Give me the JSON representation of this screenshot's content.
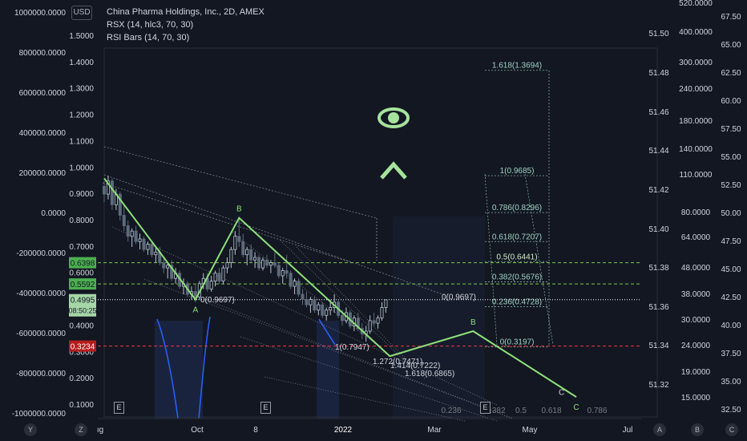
{
  "header": {
    "currency": "USD",
    "title": "China Pharma Holdings, Inc., 2D, AMEX",
    "indicator1": "RSX (14, hlc3, 70, 30)",
    "indicator2": "RSI Bars (14, 70, 30)"
  },
  "colors": {
    "background": "#131722",
    "wave": "#8ee07a",
    "up_candle": "#b7c4cf",
    "down_candle": "#5c6b7a",
    "green_dashed": "#7ec84a",
    "red_dashed": "#f23645",
    "white_dotted": "#ffffff",
    "fib_text": "#9fd3c7"
  },
  "chart_data": {
    "type": "candlestick",
    "title": "China Pharma Holdings, Inc., 2D, AMEX",
    "x_ticks": [
      "ıg",
      "Oct",
      "8",
      "2022",
      "Mar",
      "May",
      "Jul"
    ],
    "axes": {
      "far_left": {
        "ticks": [
          "1000000.0000",
          "800000.0000",
          "600000.0000",
          "400000.0000",
          "200000.0000",
          "0.0000",
          "-200000.0000",
          "-400000.0000",
          "-600000.0000",
          "-800000.0000",
          "-1000000.0000"
        ],
        "ylim": [
          -1000000,
          1000000
        ]
      },
      "left_price": {
        "ticks": [
          "1.5000",
          "1.4000",
          "1.3000",
          "1.2000",
          "1.1000",
          "1.0000",
          "0.9000",
          "0.8000",
          "0.7000",
          "0.6000",
          "0.5000",
          "0.4000",
          "0.3000",
          "0.2000",
          "0.1000"
        ],
        "ylim": [
          0.06,
          1.52
        ]
      },
      "mid": {
        "ticks": [
          "51.50",
          "51.48",
          "51.46",
          "51.44",
          "51.42",
          "51.40",
          "51.38",
          "51.36",
          "51.34",
          "51.32"
        ]
      },
      "right_log": {
        "ticks": [
          "520.0000",
          "400.0000",
          "300.0000",
          "240.0000",
          "180.0000",
          "140.0000",
          "110.0000",
          "80.0000",
          "64.0000",
          "48.0000",
          "38.0000",
          "30.0000",
          "24.0000",
          "19.0000",
          "15.0000"
        ]
      },
      "far_right": {
        "ticks": [
          "67.50",
          "65.00",
          "62.50",
          "60.00",
          "57.50",
          "55.00",
          "52.50",
          "50.00",
          "47.50",
          "45.00",
          "42.50",
          "40.00",
          "37.50",
          "35.00",
          "32.50"
        ]
      }
    },
    "price_labels": [
      {
        "value": "0.6398",
        "color": "#4caf50"
      },
      {
        "value": "0.5592",
        "color": "#4caf50"
      },
      {
        "value": "0.4995",
        "sub": "08:50:25",
        "color": "#a5d6a7"
      },
      {
        "value": "0.3234",
        "color": "#b71c1c"
      }
    ],
    "horizontal_lines": [
      {
        "price": 0.6398,
        "style": "green-dashed"
      },
      {
        "price": 0.5592,
        "style": "green-dashed"
      },
      {
        "price": 0.4995,
        "style": "white-dotted"
      },
      {
        "price": 0.3234,
        "style": "red-dashed"
      }
    ],
    "wave_points": [
      {
        "date_index": 0,
        "price": 0.96
      },
      {
        "date_index": 23,
        "price": 0.5,
        "label": "A"
      },
      {
        "date_index": 34,
        "price": 0.81,
        "label": "B"
      },
      {
        "date_index": 72,
        "price": 0.285
      },
      {
        "date_index": 93,
        "price": 0.38,
        "label": "B"
      },
      {
        "date_index": 119,
        "price": 0.13,
        "label": "C"
      }
    ],
    "annotations": [
      {
        "text": "0(0.9697)",
        "price": 0.49
      },
      {
        "text": "1(0.7947)",
        "price": 0.31
      },
      {
        "text": "1.272(0.7471)",
        "price": 0.255
      },
      {
        "text": "1.414(0.7222)",
        "price": 0.24
      },
      {
        "text": "1.618(0.6865)",
        "price": 0.21
      },
      {
        "text": "0(0.9697)",
        "price": 0.5
      },
      {
        "text": "C",
        "price": 0.235
      }
    ],
    "fib_levels": [
      {
        "text": "1.618(1.3694)",
        "price": 1.37
      },
      {
        "text": "1(0.9685)",
        "price": 0.97
      },
      {
        "text": "0.786(0.8296)",
        "price": 0.83
      },
      {
        "text": "0.618(0.7207)",
        "price": 0.72
      },
      {
        "text": "0.5(0.6441)",
        "price": 0.644
      },
      {
        "text": "0.382(0.5676)",
        "price": 0.567
      },
      {
        "text": "0.236(0.4728)",
        "price": 0.473
      },
      {
        "text": "0(0.3197)",
        "price": 0.32
      }
    ],
    "bottom_fib_labels": [
      "0.236",
      "0.382",
      "0.5",
      "0.618",
      "0.786"
    ],
    "candles": [
      [
        0.93,
        0.95,
        0.87,
        0.9
      ],
      [
        0.9,
        0.97,
        0.88,
        0.95
      ],
      [
        0.95,
        0.96,
        0.84,
        0.86
      ],
      [
        0.86,
        0.92,
        0.84,
        0.9
      ],
      [
        0.9,
        0.91,
        0.8,
        0.82
      ],
      [
        0.82,
        0.86,
        0.76,
        0.78
      ],
      [
        0.78,
        0.8,
        0.72,
        0.74
      ],
      [
        0.74,
        0.77,
        0.7,
        0.76
      ],
      [
        0.76,
        0.78,
        0.71,
        0.72
      ],
      [
        0.72,
        0.75,
        0.69,
        0.73
      ],
      [
        0.73,
        0.74,
        0.68,
        0.69
      ],
      [
        0.69,
        0.72,
        0.67,
        0.71
      ],
      [
        0.71,
        0.72,
        0.66,
        0.67
      ],
      [
        0.67,
        0.7,
        0.64,
        0.68
      ],
      [
        0.68,
        0.7,
        0.63,
        0.64
      ],
      [
        0.64,
        0.66,
        0.6,
        0.62
      ],
      [
        0.62,
        0.64,
        0.58,
        0.63
      ],
      [
        0.63,
        0.65,
        0.57,
        0.58
      ],
      [
        0.58,
        0.62,
        0.56,
        0.6
      ],
      [
        0.6,
        0.61,
        0.54,
        0.55
      ],
      [
        0.55,
        0.58,
        0.52,
        0.56
      ],
      [
        0.56,
        0.57,
        0.51,
        0.52
      ],
      [
        0.52,
        0.55,
        0.5,
        0.53
      ],
      [
        0.53,
        0.56,
        0.49,
        0.51
      ],
      [
        0.51,
        0.57,
        0.5,
        0.56
      ],
      [
        0.56,
        0.6,
        0.54,
        0.58
      ],
      [
        0.58,
        0.6,
        0.53,
        0.54
      ],
      [
        0.54,
        0.59,
        0.53,
        0.57
      ],
      [
        0.57,
        0.61,
        0.55,
        0.6
      ],
      [
        0.6,
        0.62,
        0.56,
        0.57
      ],
      [
        0.57,
        0.63,
        0.56,
        0.62
      ],
      [
        0.62,
        0.66,
        0.6,
        0.64
      ],
      [
        0.64,
        0.7,
        0.62,
        0.69
      ],
      [
        0.69,
        0.76,
        0.67,
        0.74
      ],
      [
        0.74,
        0.81,
        0.7,
        0.72
      ],
      [
        0.72,
        0.75,
        0.66,
        0.67
      ],
      [
        0.67,
        0.7,
        0.63,
        0.69
      ],
      [
        0.69,
        0.71,
        0.64,
        0.65
      ],
      [
        0.65,
        0.68,
        0.62,
        0.66
      ],
      [
        0.66,
        0.67,
        0.61,
        0.62
      ],
      [
        0.62,
        0.66,
        0.61,
        0.65
      ],
      [
        0.65,
        0.67,
        0.62,
        0.63
      ],
      [
        0.63,
        0.65,
        0.6,
        0.64
      ],
      [
        0.64,
        0.68,
        0.62,
        0.63
      ],
      [
        0.63,
        0.64,
        0.58,
        0.59
      ],
      [
        0.59,
        0.62,
        0.56,
        0.61
      ],
      [
        0.61,
        0.67,
        0.58,
        0.6
      ],
      [
        0.6,
        0.61,
        0.54,
        0.55
      ],
      [
        0.55,
        0.58,
        0.52,
        0.57
      ],
      [
        0.57,
        0.58,
        0.51,
        0.52
      ],
      [
        0.52,
        0.54,
        0.48,
        0.5
      ],
      [
        0.5,
        0.53,
        0.47,
        0.48
      ],
      [
        0.48,
        0.51,
        0.45,
        0.5
      ],
      [
        0.5,
        0.51,
        0.45,
        0.46
      ],
      [
        0.46,
        0.49,
        0.44,
        0.48
      ],
      [
        0.48,
        0.49,
        0.43,
        0.44
      ],
      [
        0.44,
        0.47,
        0.42,
        0.46
      ],
      [
        0.46,
        0.5,
        0.44,
        0.47
      ],
      [
        0.47,
        0.52,
        0.45,
        0.49
      ],
      [
        0.49,
        0.5,
        0.43,
        0.44
      ],
      [
        0.44,
        0.46,
        0.4,
        0.42
      ],
      [
        0.42,
        0.47,
        0.41,
        0.45
      ],
      [
        0.45,
        0.46,
        0.39,
        0.4
      ],
      [
        0.4,
        0.44,
        0.38,
        0.43
      ],
      [
        0.43,
        0.45,
        0.38,
        0.39
      ],
      [
        0.39,
        0.41,
        0.35,
        0.37
      ],
      [
        0.37,
        0.4,
        0.34,
        0.38
      ],
      [
        0.38,
        0.44,
        0.37,
        0.42
      ],
      [
        0.42,
        0.45,
        0.4,
        0.41
      ],
      [
        0.41,
        0.44,
        0.39,
        0.43
      ],
      [
        0.43,
        0.49,
        0.42,
        0.47
      ],
      [
        0.47,
        0.5,
        0.45,
        0.499
      ]
    ]
  }
}
